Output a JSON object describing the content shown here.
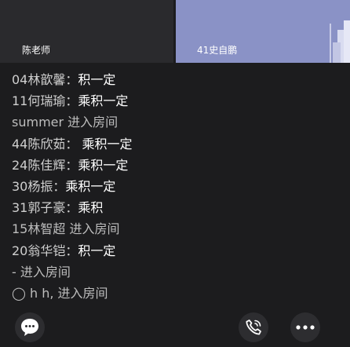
{
  "video": {
    "teacher_name": "陈老师",
    "student_name": "41史自鹏"
  },
  "chat": {
    "messages": [
      {
        "name": "04林歆馨：",
        "text": "积一定",
        "type": "user"
      },
      {
        "name": "11何瑞瑜：",
        "text": "乘积一定",
        "type": "user"
      },
      {
        "name": "summer ",
        "text": "进入房间",
        "type": "system"
      },
      {
        "name": "44陈欣茹：",
        "text": " 乘积一定",
        "type": "user"
      },
      {
        "name": "24陈佳辉：",
        "text": "乘积一定",
        "type": "user"
      },
      {
        "name": "30杨振：",
        "text": "乘积一定",
        "type": "user"
      },
      {
        "name": "31郭子豪：",
        "text": "乘积",
        "type": "user"
      },
      {
        "name": "15林智超 ",
        "text": "进入房间",
        "type": "system"
      },
      {
        "name": "20翁华铠：",
        "text": "积一定",
        "type": "user"
      },
      {
        "name": "- ",
        "text": "进入房间",
        "type": "system"
      },
      {
        "name": "◯ h h, ",
        "text": "进入房间",
        "type": "system"
      }
    ]
  },
  "toolbar": {
    "chat_icon": "speech-bubble-icon",
    "call_icon": "phone-icon",
    "more_icon": "more-dots-icon"
  }
}
